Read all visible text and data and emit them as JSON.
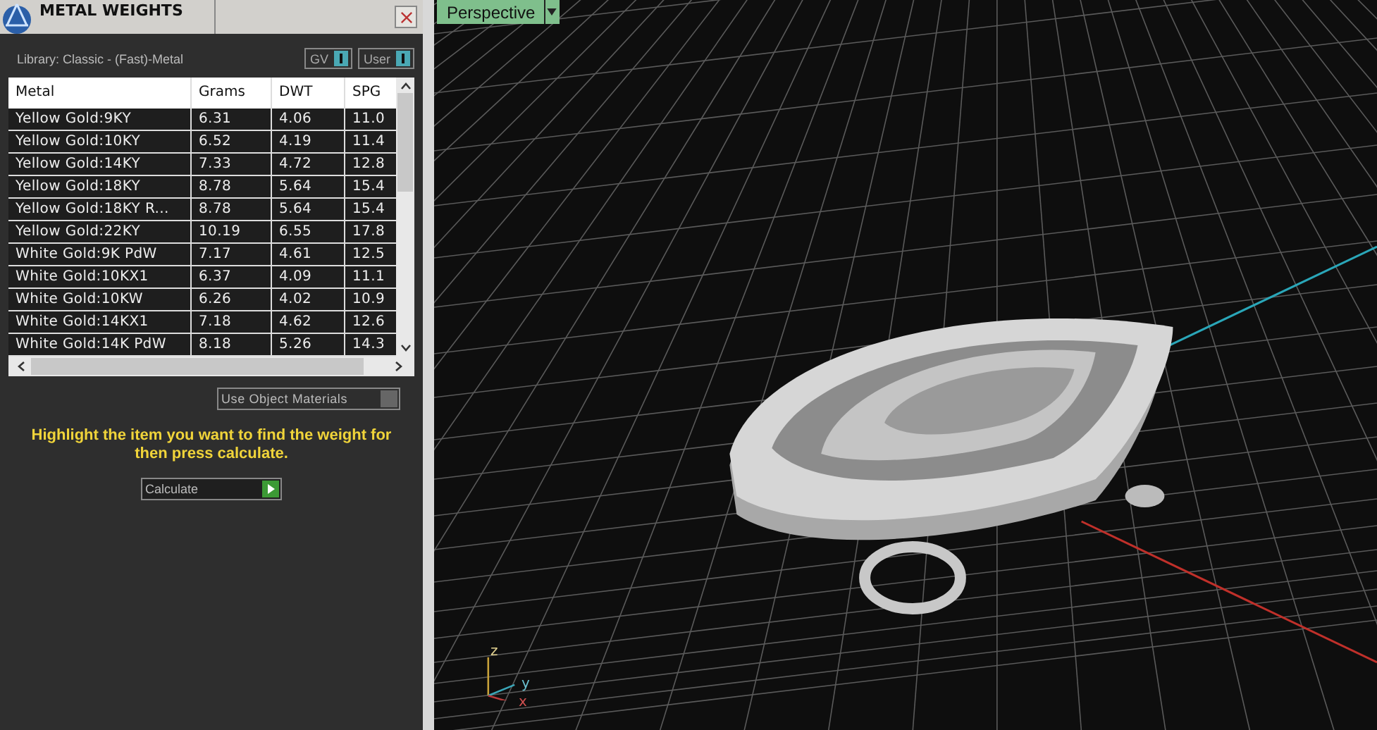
{
  "panel": {
    "title": "METAL WEIGHTS",
    "library": "Library: Classic - (Fast)-Metal",
    "toggles": [
      {
        "label": "GV",
        "on": true
      },
      {
        "label": "User",
        "on": true
      }
    ],
    "table": {
      "columns": [
        "Metal",
        "Grams",
        "DWT",
        "SPG"
      ],
      "rows": [
        [
          "Yellow Gold:9KY",
          "6.31",
          "4.06",
          "11.0"
        ],
        [
          "Yellow Gold:10KY",
          "6.52",
          "4.19",
          "11.4"
        ],
        [
          "Yellow Gold:14KY",
          "7.33",
          "4.72",
          "12.8"
        ],
        [
          "Yellow Gold:18KY",
          "8.78",
          "5.64",
          "15.4"
        ],
        [
          "Yellow Gold:18KY R...",
          "8.78",
          "5.64",
          "15.4"
        ],
        [
          "Yellow Gold:22KY",
          "10.19",
          "6.55",
          "17.8"
        ],
        [
          "White Gold:9K PdW",
          "7.17",
          "4.61",
          "12.5"
        ],
        [
          "White Gold:10KX1",
          "6.37",
          "4.09",
          "11.1"
        ],
        [
          "White Gold:10KW",
          "6.26",
          "4.02",
          "10.9"
        ],
        [
          "White Gold:14KX1",
          "7.18",
          "4.62",
          "12.6"
        ],
        [
          "White Gold:14K PdW",
          "8.18",
          "5.26",
          "14.3"
        ]
      ]
    },
    "use_object_materials": {
      "label": "Use Object Materials",
      "checked": false
    },
    "hint": "Highlight the item you want to find the weight for then press calculate.",
    "calculate": "Calculate"
  },
  "viewport": {
    "view": "Perspective",
    "axes": [
      "z",
      "y",
      "x"
    ]
  }
}
